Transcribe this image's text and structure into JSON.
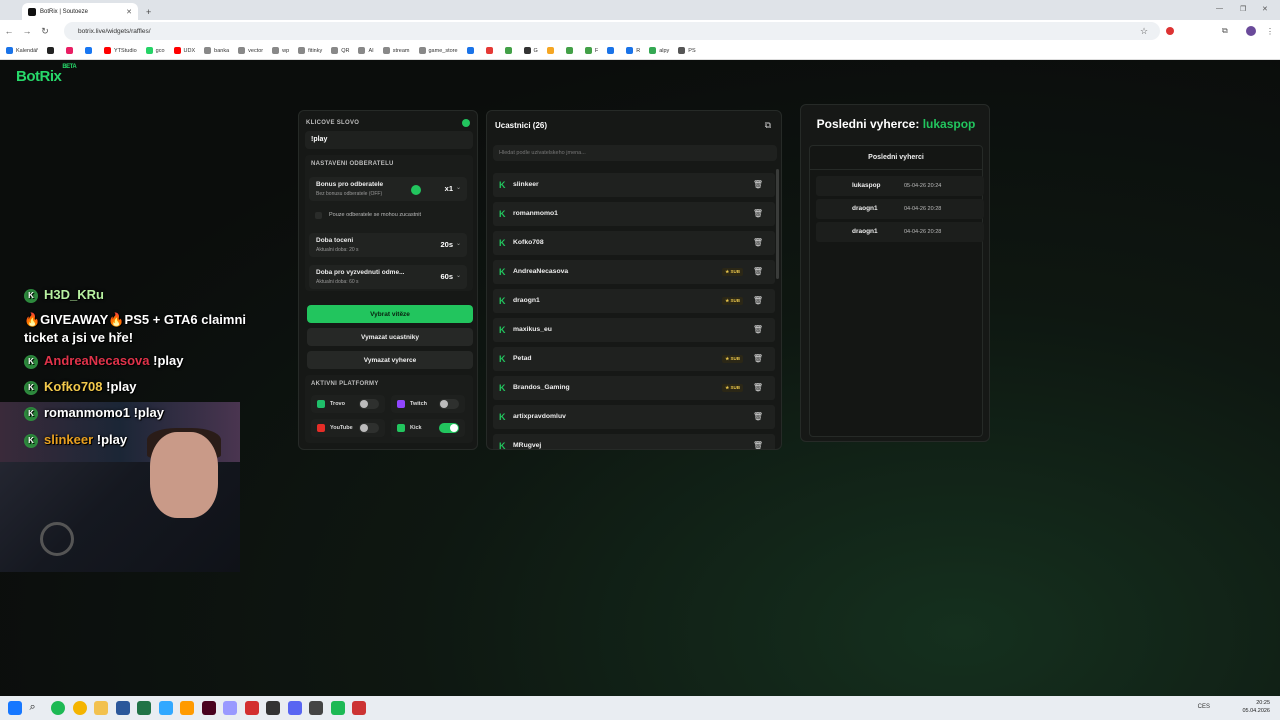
{
  "browser": {
    "tab_title": "BotRix | Soutoeze",
    "url": "botrix.live/widgets/raffles/",
    "bookmarks": [
      "Kalendář",
      "",
      "",
      "",
      "YTStudio",
      "gco",
      "UDX",
      "banka",
      "vector",
      "wp",
      "fitinky",
      "QR",
      "AI",
      "stream",
      "game_store",
      "",
      "",
      "",
      "G",
      "",
      "",
      "F",
      "",
      "R",
      "alpy",
      "PS"
    ]
  },
  "app": {
    "logo": "BotRix",
    "logo_badge": "BETA"
  },
  "settings": {
    "keyword_label": "KLICOVE SLOVO",
    "keyword_value": "!play",
    "subscriber_section": "NASTAVENI ODBERATELU",
    "bonus_title": "Bonus pro odberatele",
    "bonus_sub": "Bez bonusu odberatele (OFF)",
    "bonus_value": "x1",
    "subs_only": "Pouze odberatele se mohou zucastnit",
    "spin_title": "Doba toceni",
    "spin_sub": "Aktualni doba: 20 s",
    "spin_value": "20s",
    "claim_title": "Doba pro vyzvednuti odme...",
    "claim_sub": "Aktualni doba: 60 s",
    "claim_value": "60s",
    "btn_pick": "Vybrat vitěze",
    "btn_clear_participants": "Vymazat ucastniky",
    "btn_clear_winners": "Vymazat vyherce",
    "platforms_label": "AKTIVNI PLATFORMY",
    "platforms": [
      {
        "name": "Trovo",
        "on": false
      },
      {
        "name": "Twitch",
        "on": false
      },
      {
        "name": "YouTube",
        "on": false
      },
      {
        "name": "Kick",
        "on": true
      }
    ]
  },
  "participants": {
    "title": "Ucastnici (26)",
    "search_placeholder": "Hledat podle uzivatelskeho jmena...",
    "sub_badge": "SUB",
    "rows": [
      {
        "name": "slinkeer",
        "sub": false
      },
      {
        "name": "romanmomo1",
        "sub": false
      },
      {
        "name": "Kofko708",
        "sub": false
      },
      {
        "name": "AndreaNecasova",
        "sub": true
      },
      {
        "name": "draogn1",
        "sub": true
      },
      {
        "name": "maxikus_eu",
        "sub": false
      },
      {
        "name": "Petad",
        "sub": true
      },
      {
        "name": "Brandos_Gaming",
        "sub": true
      },
      {
        "name": "artixpravdomluv",
        "sub": false
      },
      {
        "name": "MRugvej",
        "sub": false
      }
    ]
  },
  "winners": {
    "title": "Posledni vyherce:",
    "title_name": "lukaspop",
    "list_title": "Posledni vyherci",
    "rows": [
      {
        "name": "lukaspop",
        "date": "05-04-26 20:24"
      },
      {
        "name": "draogn1",
        "date": "04-04-26 20:28"
      },
      {
        "name": "draogn1",
        "date": "04-04-26 20:28"
      }
    ]
  },
  "chat": [
    {
      "user": "H3D_KRu",
      "msg": ""
    },
    {
      "user": "",
      "msg": "🔥GIVEAWAY🔥PS5 + GTA6 claimni"
    },
    {
      "user": "",
      "msg": "ticket a jsi ve hře!"
    },
    {
      "user": "AndreaNecasova",
      "msg": "!play"
    },
    {
      "user": "Kofko708",
      "msg": "!play"
    },
    {
      "user": "romanmomo1",
      "msg": "!play"
    },
    {
      "user": "slinkeer",
      "msg": "!play"
    }
  ],
  "taskbar": {
    "lang": "CES",
    "time": "20:25",
    "date": "05.04.2026"
  }
}
